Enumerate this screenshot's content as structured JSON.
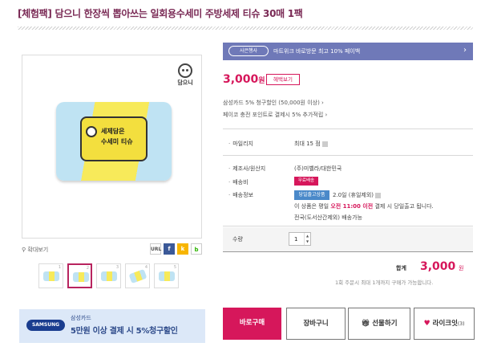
{
  "product": {
    "title": "[체험팩] 담으니 한장씩 뽑아쓰는 일회용수세미 주방세제 티슈 30매 1팩",
    "brand_logo_text": "담으니",
    "pack_label_line1": "세제담은",
    "pack_label_line2": "수세미 티슈"
  },
  "gallery": {
    "zoom_label": "확대보기",
    "share": {
      "url": "URL",
      "facebook": "f",
      "kakaostory": "k",
      "blog": "b"
    },
    "thumbnails": [
      "1",
      "2",
      "3",
      "4",
      "5"
    ],
    "active_thumb": 1
  },
  "card_banner": {
    "card_logo": "SAMSUNG",
    "line1": "삼성카드",
    "line2": "5만원 이상 결제 시 5%청구할인"
  },
  "promo": {
    "tag": "사은행사",
    "text": "마트위크 바로방문 최고 10% 페이백"
  },
  "price": {
    "amount": "3,000",
    "unit": "원",
    "benefit_button": "혜택보기"
  },
  "discounts": {
    "line1": "삼성카드 5% 청구할인 (50,000원 이상) ›",
    "line2": "페이코 충전 포인트로 결제시 5% 추가적립 ›"
  },
  "info": {
    "mileage_label": "마일리지",
    "mileage_value": "최대 15 점",
    "maker_label": "제조사/원산지",
    "maker_value": "(주)미벨라/대한민국",
    "delivery_fee_label": "배송비",
    "delivery_fee_badge": "무료배송",
    "shipping_label": "배송정보",
    "shipping_badge": "당일출고상품",
    "shipping_line1": "2.0일 (휴일제외)",
    "shipping_line2_pre": "이 상품은 평일",
    "shipping_line2_em": "오전 11:00 이전",
    "shipping_line2_post": "결제 시 당일출고 됩니다.",
    "shipping_line3": "전국(도서산간제외) 배송가능"
  },
  "quantity": {
    "label": "수량",
    "value": "1"
  },
  "total": {
    "label": "합계",
    "amount": "3,000",
    "unit": "원",
    "limit_note": "1회 주문시 최대 1개까지 구매가 가능합니다."
  },
  "actions": {
    "buy": "바로구매",
    "cart": "장바구니",
    "gift": "선물하기",
    "like": "라이크잇",
    "like_count": "(3)"
  },
  "colors": {
    "accent": "#d6175b",
    "promo_bar": "#6f79b8",
    "title": "#7a2a55",
    "banner_bg": "#dce8f8",
    "shipping_badge": "#4a89c9"
  }
}
